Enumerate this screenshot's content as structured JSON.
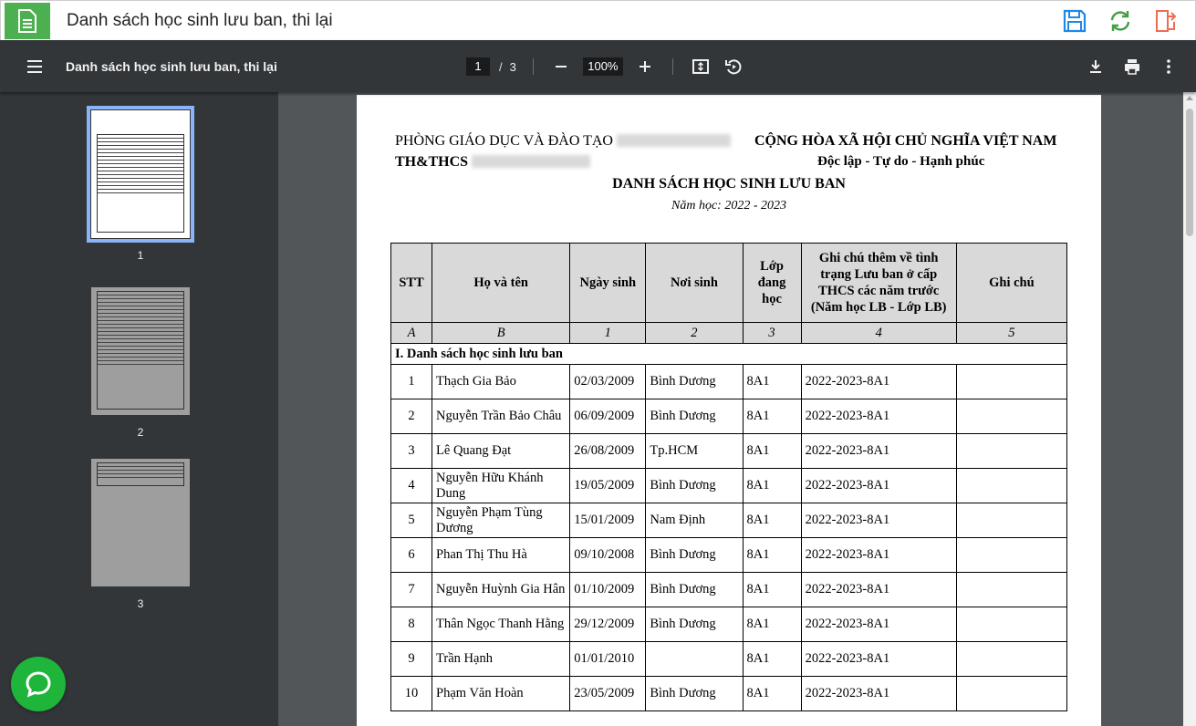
{
  "app": {
    "title": "Danh sách học sinh lưu ban, thi lại",
    "accent": "#4caf50",
    "icons": [
      "document-icon",
      "save-icon",
      "sync-icon",
      "exit-icon"
    ]
  },
  "toolbar": {
    "title": "Danh sách học sinh lưu ban, thi lại",
    "page_current": "1",
    "page_sep": "/",
    "page_total": "3",
    "zoom": "100%"
  },
  "thumbnails": [
    {
      "label": "1"
    },
    {
      "label": "2"
    },
    {
      "label": "3"
    }
  ],
  "document": {
    "org_left_1": "PHÒNG GIÁO DỤC VÀ ĐÀO TẠO",
    "org_left_2": "TH&THCS",
    "org_right_1": "CỘNG HÒA XÃ HỘI CHỦ NGHĨA VIỆT NAM",
    "org_right_2": "Độc lập - Tự do - Hạnh phúc",
    "title": "DANH SÁCH HỌC SINH LƯU BAN",
    "school_year": "Năm học: 2022 - 2023",
    "columns": [
      "STT",
      "Họ và tên",
      "Ngày sinh",
      "Nơi sinh",
      "Lớp đang học",
      "Ghi chú thêm về tình trạng Lưu ban ở cấp THCS các năm trước (Năm học LB - Lớp LB)",
      "Ghi chú"
    ],
    "column_codes": [
      "A",
      "B",
      "1",
      "2",
      "3",
      "4",
      "5"
    ],
    "section_label": "I. Danh sách học sinh lưu ban",
    "rows": [
      {
        "stt": "1",
        "name": "Thạch Gia Bảo",
        "dob": "02/03/2009",
        "place": "Bình Dương",
        "class": "8A1",
        "note": "2022-2023-8A1",
        "remark": ""
      },
      {
        "stt": "2",
        "name": "Nguyễn Trần Bảo Châu",
        "dob": "06/09/2009",
        "place": "Bình Dương",
        "class": "8A1",
        "note": "2022-2023-8A1",
        "remark": ""
      },
      {
        "stt": "3",
        "name": "Lê Quang Đạt",
        "dob": "26/08/2009",
        "place": "Tp.HCM",
        "class": "8A1",
        "note": "2022-2023-8A1",
        "remark": ""
      },
      {
        "stt": "4",
        "name": "Nguyễn Hữu Khánh Dung",
        "dob": "19/05/2009",
        "place": "Bình Dương",
        "class": "8A1",
        "note": "2022-2023-8A1",
        "remark": ""
      },
      {
        "stt": "5",
        "name": "Nguyễn Phạm Tùng Dương",
        "dob": "15/01/2009",
        "place": "Nam Định",
        "class": "8A1",
        "note": "2022-2023-8A1",
        "remark": ""
      },
      {
        "stt": "6",
        "name": "Phan Thị Thu Hà",
        "dob": "09/10/2008",
        "place": "Bình Dương",
        "class": "8A1",
        "note": "2022-2023-8A1",
        "remark": ""
      },
      {
        "stt": "7",
        "name": "Nguyễn Huỳnh Gia Hân",
        "dob": "01/10/2009",
        "place": "Bình Dương",
        "class": "8A1",
        "note": "2022-2023-8A1",
        "remark": ""
      },
      {
        "stt": "8",
        "name": "Thân Ngọc Thanh Hằng",
        "dob": "29/12/2009",
        "place": "Bình Dương",
        "class": "8A1",
        "note": "2022-2023-8A1",
        "remark": ""
      },
      {
        "stt": "9",
        "name": "Trần Hạnh",
        "dob": "01/01/2010",
        "place": "",
        "class": "8A1",
        "note": "2022-2023-8A1",
        "remark": ""
      },
      {
        "stt": "10",
        "name": "Phạm Văn Hoàn",
        "dob": "23/05/2009",
        "place": "Bình Dương",
        "class": "8A1",
        "note": "2022-2023-8A1",
        "remark": ""
      }
    ]
  },
  "chat": {
    "icon": "chat-bubble-icon",
    "color": "#1fb43a"
  }
}
